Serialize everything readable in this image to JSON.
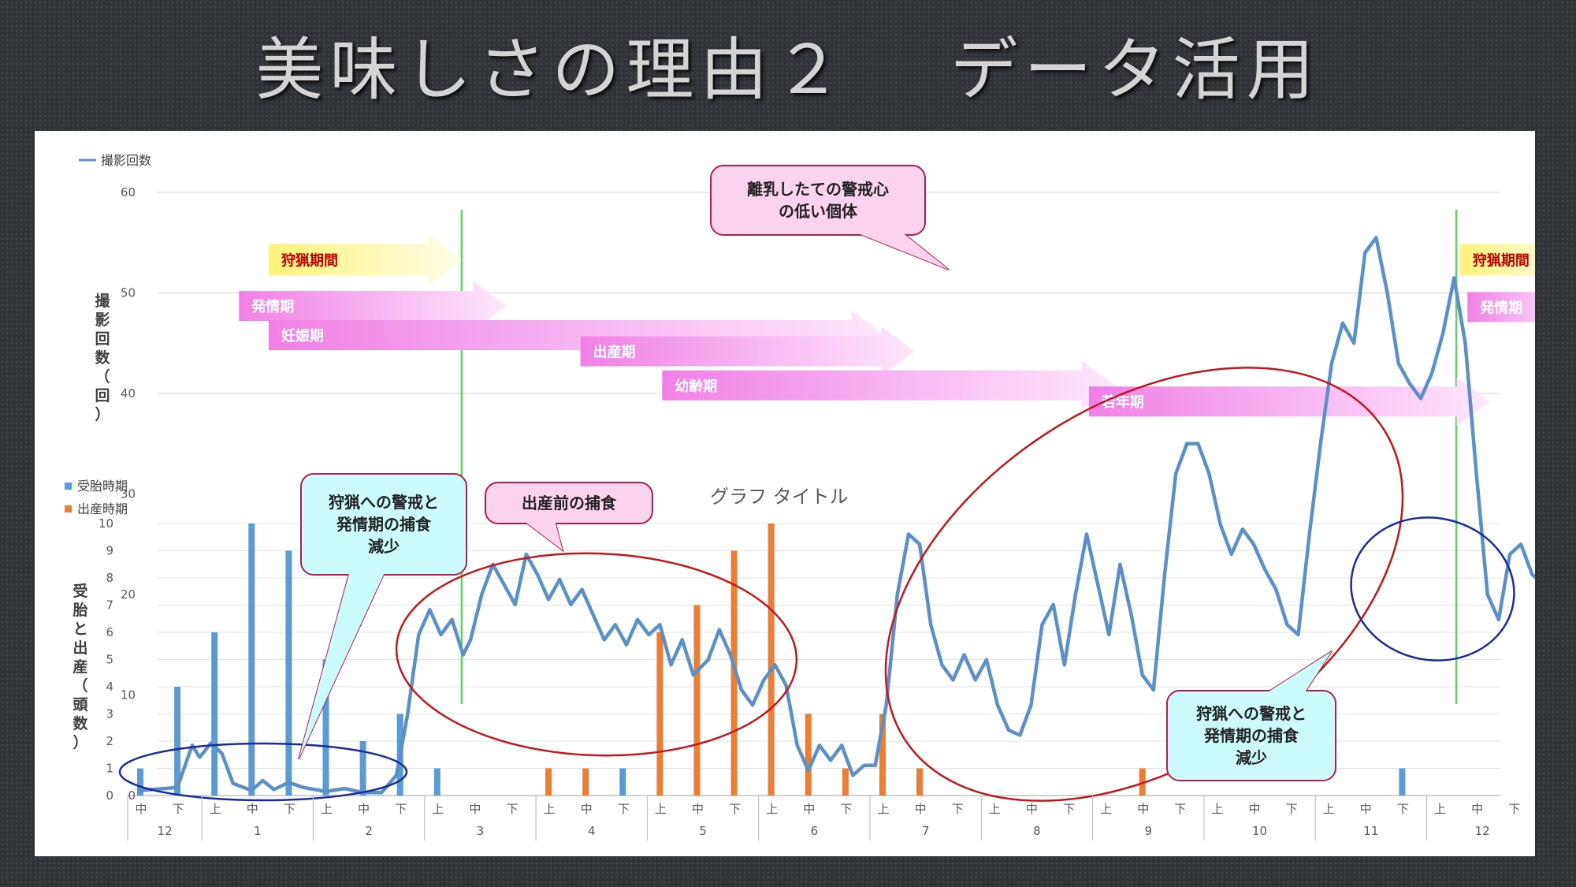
{
  "slide": {
    "title": "美味しさの理由２　 データ活用"
  },
  "colors": {
    "line": "#5b8fc6",
    "bar_conception": "#5b9bd5",
    "bar_birth": "#ed7d31",
    "hunting_arrow": "#fff59a",
    "hunting_text": "#c00000",
    "phase_arrow": "#f39cec",
    "season_line": "#5fd35f",
    "red_ellipse": "#c0181f",
    "blue_ellipse": "#1b2b9c",
    "callout_pink": "#fbd3ee",
    "callout_pink_border": "#b0204a",
    "callout_cyan": "#ccfbfb",
    "callout_cyan_border": "#b0204a"
  },
  "chart_data": {
    "type": "line",
    "chart_title": "グラフ タイトル",
    "legend_line": "撮影回数",
    "legend_bars": [
      "受胎時期",
      "出産時期"
    ],
    "ylabel_photos": "撮影回数（回）",
    "ylabel_photos_parts": [
      "撮",
      "影",
      "回",
      "数",
      "（",
      "回",
      "）"
    ],
    "ylabel_births_parts": [
      "受",
      "胎",
      "と",
      "出",
      "産",
      "（",
      "頭",
      "数",
      "）"
    ],
    "y_photos_ticks": [
      "0",
      "10",
      "20",
      "30",
      "40",
      "50",
      "60"
    ],
    "y_photos_range": [
      0,
      60
    ],
    "y_births_ticks": [
      "0",
      "1",
      "2",
      "3",
      "4",
      "5",
      "6",
      "7",
      "8",
      "9",
      "10"
    ],
    "y_births_range": [
      0,
      10
    ],
    "x_sub_labels": [
      "中",
      "下",
      "上",
      "中",
      "下",
      "上",
      "中",
      "下",
      "上",
      "中",
      "下",
      "上",
      "中",
      "下",
      "上",
      "中",
      "下",
      "上",
      "中",
      "下",
      "上",
      "中",
      "下",
      "上",
      "中",
      "下",
      "上",
      "中",
      "下",
      "上",
      "中",
      "下",
      "上",
      "中",
      "下",
      "上",
      "中",
      "下"
    ],
    "x_month_labels": [
      "12",
      "1",
      "2",
      "3",
      "4",
      "5",
      "6",
      "7",
      "8",
      "9",
      "10",
      "11",
      "12"
    ],
    "month_spans": [
      2,
      3,
      3,
      3,
      3,
      3,
      3,
      3,
      3,
      3,
      3,
      3,
      3
    ],
    "photo_series": [
      {
        "x": 0.0,
        "y": 0.5
      },
      {
        "x": 1.0,
        "y": 0.8
      },
      {
        "x": 1.4,
        "y": 5.0
      },
      {
        "x": 1.6,
        "y": 3.8
      },
      {
        "x": 1.9,
        "y": 5.2
      },
      {
        "x": 2.2,
        "y": 4.2
      },
      {
        "x": 2.5,
        "y": 1.2
      },
      {
        "x": 3.0,
        "y": 0.5
      },
      {
        "x": 3.3,
        "y": 1.5
      },
      {
        "x": 3.6,
        "y": 0.6
      },
      {
        "x": 4.0,
        "y": 1.3
      },
      {
        "x": 4.4,
        "y": 0.8
      },
      {
        "x": 5.0,
        "y": 0.4
      },
      {
        "x": 5.5,
        "y": 0.7
      },
      {
        "x": 6.0,
        "y": 0.3
      },
      {
        "x": 6.5,
        "y": 0.3
      },
      {
        "x": 6.9,
        "y": 2.0
      },
      {
        "x": 7.2,
        "y": 8.0
      },
      {
        "x": 7.5,
        "y": 16.0
      },
      {
        "x": 7.8,
        "y": 18.5
      },
      {
        "x": 8.1,
        "y": 16.0
      },
      {
        "x": 8.4,
        "y": 17.5
      },
      {
        "x": 8.7,
        "y": 14.0
      },
      {
        "x": 8.9,
        "y": 15.5
      },
      {
        "x": 9.2,
        "y": 20.0
      },
      {
        "x": 9.5,
        "y": 23.0
      },
      {
        "x": 9.8,
        "y": 21.0
      },
      {
        "x": 10.1,
        "y": 19.0
      },
      {
        "x": 10.4,
        "y": 24.0
      },
      {
        "x": 10.7,
        "y": 22.0
      },
      {
        "x": 11.0,
        "y": 19.5
      },
      {
        "x": 11.3,
        "y": 21.5
      },
      {
        "x": 11.6,
        "y": 19.0
      },
      {
        "x": 11.9,
        "y": 20.5
      },
      {
        "x": 12.2,
        "y": 18.0
      },
      {
        "x": 12.5,
        "y": 15.5
      },
      {
        "x": 12.8,
        "y": 17.0
      },
      {
        "x": 13.1,
        "y": 15.0
      },
      {
        "x": 13.4,
        "y": 17.5
      },
      {
        "x": 13.7,
        "y": 16.0
      },
      {
        "x": 14.0,
        "y": 17.0
      },
      {
        "x": 14.3,
        "y": 13.0
      },
      {
        "x": 14.6,
        "y": 15.5
      },
      {
        "x": 14.9,
        "y": 12.0
      },
      {
        "x": 15.3,
        "y": 13.5
      },
      {
        "x": 15.6,
        "y": 16.5
      },
      {
        "x": 15.9,
        "y": 14.0
      },
      {
        "x": 16.2,
        "y": 10.5
      },
      {
        "x": 16.5,
        "y": 9.0
      },
      {
        "x": 16.8,
        "y": 11.5
      },
      {
        "x": 17.1,
        "y": 13.0
      },
      {
        "x": 17.4,
        "y": 11.0
      },
      {
        "x": 17.7,
        "y": 5.0
      },
      {
        "x": 18.0,
        "y": 2.5
      },
      {
        "x": 18.3,
        "y": 5.0
      },
      {
        "x": 18.6,
        "y": 3.5
      },
      {
        "x": 18.9,
        "y": 5.0
      },
      {
        "x": 19.2,
        "y": 2.0
      },
      {
        "x": 19.5,
        "y": 3.0
      },
      {
        "x": 19.8,
        "y": 3.0
      },
      {
        "x": 20.1,
        "y": 9.0
      },
      {
        "x": 20.4,
        "y": 20.0
      },
      {
        "x": 20.7,
        "y": 26.0
      },
      {
        "x": 21.0,
        "y": 25.0
      },
      {
        "x": 21.3,
        "y": 17.0
      },
      {
        "x": 21.6,
        "y": 13.0
      },
      {
        "x": 21.9,
        "y": 11.5
      },
      {
        "x": 22.2,
        "y": 14.0
      },
      {
        "x": 22.5,
        "y": 11.5
      },
      {
        "x": 22.8,
        "y": 13.5
      },
      {
        "x": 23.1,
        "y": 9.0
      },
      {
        "x": 23.4,
        "y": 6.5
      },
      {
        "x": 23.7,
        "y": 6.0
      },
      {
        "x": 24.0,
        "y": 9.0
      },
      {
        "x": 24.3,
        "y": 17.0
      },
      {
        "x": 24.6,
        "y": 19.0
      },
      {
        "x": 24.9,
        "y": 13.0
      },
      {
        "x": 25.2,
        "y": 20.0
      },
      {
        "x": 25.5,
        "y": 26.0
      },
      {
        "x": 25.8,
        "y": 21.0
      },
      {
        "x": 26.1,
        "y": 16.0
      },
      {
        "x": 26.4,
        "y": 23.0
      },
      {
        "x": 26.7,
        "y": 18.0
      },
      {
        "x": 27.0,
        "y": 12.0
      },
      {
        "x": 27.3,
        "y": 10.5
      },
      {
        "x": 27.6,
        "y": 22.0
      },
      {
        "x": 27.9,
        "y": 32.0
      },
      {
        "x": 28.2,
        "y": 35.0
      },
      {
        "x": 28.5,
        "y": 35.0
      },
      {
        "x": 28.8,
        "y": 32.0
      },
      {
        "x": 29.1,
        "y": 27.0
      },
      {
        "x": 29.4,
        "y": 24.0
      },
      {
        "x": 29.7,
        "y": 26.5
      },
      {
        "x": 30.0,
        "y": 25.0
      },
      {
        "x": 30.3,
        "y": 22.5
      },
      {
        "x": 30.6,
        "y": 20.5
      },
      {
        "x": 30.9,
        "y": 17.0
      },
      {
        "x": 31.2,
        "y": 16.0
      },
      {
        "x": 31.5,
        "y": 26.0
      },
      {
        "x": 31.8,
        "y": 35.0
      },
      {
        "x": 32.1,
        "y": 43.0
      },
      {
        "x": 32.4,
        "y": 47.0
      },
      {
        "x": 32.7,
        "y": 45.0
      },
      {
        "x": 33.0,
        "y": 54.0
      },
      {
        "x": 33.3,
        "y": 55.5
      },
      {
        "x": 33.6,
        "y": 50.0
      },
      {
        "x": 33.9,
        "y": 43.0
      },
      {
        "x": 34.2,
        "y": 41.0
      },
      {
        "x": 34.5,
        "y": 39.5
      },
      {
        "x": 34.8,
        "y": 42.0
      },
      {
        "x": 35.1,
        "y": 46.0
      },
      {
        "x": 35.4,
        "y": 51.5
      },
      {
        "x": 35.7,
        "y": 45.0
      },
      {
        "x": 36.0,
        "y": 32.0
      },
      {
        "x": 36.3,
        "y": 20.0
      },
      {
        "x": 36.6,
        "y": 17.5
      },
      {
        "x": 36.9,
        "y": 24.0
      },
      {
        "x": 37.2,
        "y": 25.0
      },
      {
        "x": 37.5,
        "y": 22.0
      },
      {
        "x": 37.8,
        "y": 21.0
      },
      {
        "x": 38.1,
        "y": 19.0
      },
      {
        "x": 38.4,
        "y": 16.0
      },
      {
        "x": 38.7,
        "y": 15.0
      },
      {
        "x": 39.0,
        "y": 17.5
      },
      {
        "x": 39.3,
        "y": 17.0
      },
      {
        "x": 39.6,
        "y": 19.0
      },
      {
        "x": 39.9,
        "y": 20.0
      },
      {
        "x": 40.2,
        "y": 18.0
      },
      {
        "x": 40.5,
        "y": 15.0
      },
      {
        "x": 40.8,
        "y": 14.5
      },
      {
        "x": 41.0,
        "y": 15.0
      }
    ],
    "conception_bars": [
      {
        "x": 0.0,
        "value": 1
      },
      {
        "x": 1.0,
        "value": 4
      },
      {
        "x": 2.0,
        "value": 6
      },
      {
        "x": 3.0,
        "value": 10
      },
      {
        "x": 4.0,
        "value": 9
      },
      {
        "x": 5.0,
        "value": 5
      },
      {
        "x": 6.0,
        "value": 2
      },
      {
        "x": 7.0,
        "value": 3
      },
      {
        "x": 8.0,
        "value": 1
      },
      {
        "x": 13.0,
        "value": 1
      },
      {
        "x": 34.0,
        "value": 1
      }
    ],
    "birth_bars": [
      {
        "x": 11.0,
        "value": 1
      },
      {
        "x": 12.0,
        "value": 1
      },
      {
        "x": 14.0,
        "value": 6
      },
      {
        "x": 15.0,
        "value": 7
      },
      {
        "x": 16.0,
        "value": 9
      },
      {
        "x": 17.0,
        "value": 10
      },
      {
        "x": 18.0,
        "value": 3
      },
      {
        "x": 19.0,
        "value": 1
      },
      {
        "x": 20.0,
        "value": 3
      },
      {
        "x": 21.0,
        "value": 1
      },
      {
        "x": 27.0,
        "value": 1
      }
    ],
    "season_lines_x": [
      9.0,
      35.8
    ],
    "phase_arrows": [
      {
        "label": "狩猟期間",
        "kind": "hunting",
        "start": 3.8,
        "end": 9.0,
        "y": 53.3
      },
      {
        "label": "発情期",
        "kind": "phase",
        "start": 3.0,
        "end": 10.2,
        "y": 48.7
      },
      {
        "label": "妊娠期",
        "kind": "phase",
        "start": 3.8,
        "end": 20.4,
        "y": 45.8
      },
      {
        "label": "出産期",
        "kind": "phase",
        "start": 12.2,
        "end": 21.2,
        "y": 44.2
      },
      {
        "label": "幼齢期",
        "kind": "phase",
        "start": 14.4,
        "end": 26.6,
        "y": 40.8
      },
      {
        "label": "若年期",
        "kind": "phase",
        "start": 25.9,
        "end": 36.7,
        "y": 39.2
      },
      {
        "label": "狩猟期間",
        "kind": "hunting",
        "start": 35.9,
        "end": 38.9,
        "y": 53.3
      },
      {
        "label": "発情期",
        "kind": "phase",
        "start": 36.1,
        "end": 38.9,
        "y": 48.6
      }
    ],
    "callouts": [
      {
        "lines": [
          "離乳したての警戒心",
          "の低い個体"
        ],
        "style": "pink"
      },
      {
        "lines": [
          "狩猟への警戒と",
          "発情期の捕食",
          "減少"
        ],
        "style": "cyan"
      },
      {
        "lines": [
          "出産前の捕食"
        ],
        "style": "pink"
      },
      {
        "lines": [
          "狩猟への警戒と",
          "発情期の捕食",
          "減少"
        ],
        "style": "cyan"
      }
    ]
  }
}
